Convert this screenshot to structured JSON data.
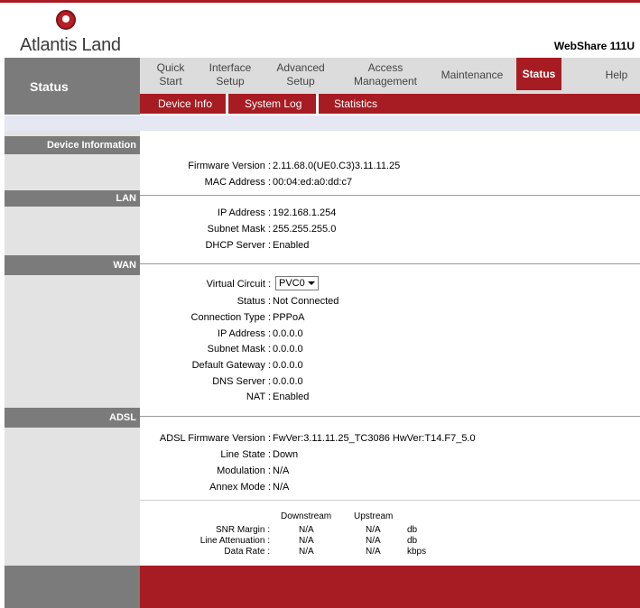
{
  "brand": {
    "logo_text": "Atlantis Land",
    "model": "WebShare 111U"
  },
  "nav": {
    "current_section": "Status",
    "items": [
      {
        "label": "Quick\nStart"
      },
      {
        "label": "Interface\nSetup"
      },
      {
        "label": "Advanced\nSetup"
      },
      {
        "label": "Access\nManagement"
      },
      {
        "label": "Maintenance"
      },
      {
        "label": "Status"
      },
      {
        "label": "Help"
      }
    ]
  },
  "subnav": [
    "Device Info",
    "System Log",
    "Statistics"
  ],
  "sections": {
    "device": "Device Information",
    "lan": "LAN",
    "wan": "WAN",
    "adsl": "ADSL"
  },
  "device": {
    "firmware_label": "Firmware Version :",
    "firmware_value": "2.11.68.0(UE0.C3)3.11.11.25",
    "mac_label": "MAC Address :",
    "mac_value": "00:04:ed:a0:dd:c7"
  },
  "lan": {
    "ip_label": "IP Address :",
    "ip_value": "192.168.1.254",
    "mask_label": "Subnet Mask :",
    "mask_value": "255.255.255.0",
    "dhcp_label": "DHCP Server :",
    "dhcp_value": "Enabled"
  },
  "wan": {
    "vc_label": "Virtual Circuit :",
    "vc_value": "PVC0",
    "status_label": "Status :",
    "status_value": "Not Connected",
    "conn_label": "Connection Type :",
    "conn_value": "PPPoA",
    "ip_label": "IP Address :",
    "ip_value": "0.0.0.0",
    "mask_label": "Subnet Mask :",
    "mask_value": "0.0.0.0",
    "gw_label": "Default Gateway :",
    "gw_value": "0.0.0.0",
    "dns_label": "DNS Server :",
    "dns_value": "0.0.0.0",
    "nat_label": "NAT :",
    "nat_value": "Enabled"
  },
  "adsl": {
    "fw_label": "ADSL Firmware Version :",
    "fw_value": "FwVer:3.11.11.25_TC3086 HwVer:T14.F7_5.0",
    "line_label": "Line State :",
    "line_value": "Down",
    "mod_label": "Modulation :",
    "mod_value": "N/A",
    "annex_label": "Annex Mode :",
    "annex_value": "N/A"
  },
  "stats": {
    "headers": [
      "Downstream",
      "Upstream"
    ],
    "rows": [
      {
        "label": "SNR Margin :",
        "down": "N/A",
        "up": "N/A",
        "unit": "db"
      },
      {
        "label": "Line Attenuation :",
        "down": "N/A",
        "up": "N/A",
        "unit": "db"
      },
      {
        "label": "Data Rate :",
        "down": "N/A",
        "up": "N/A",
        "unit": "kbps"
      }
    ]
  },
  "colors": {
    "brand_red": "#a71c22",
    "side_grey": "#7b7b7b"
  }
}
